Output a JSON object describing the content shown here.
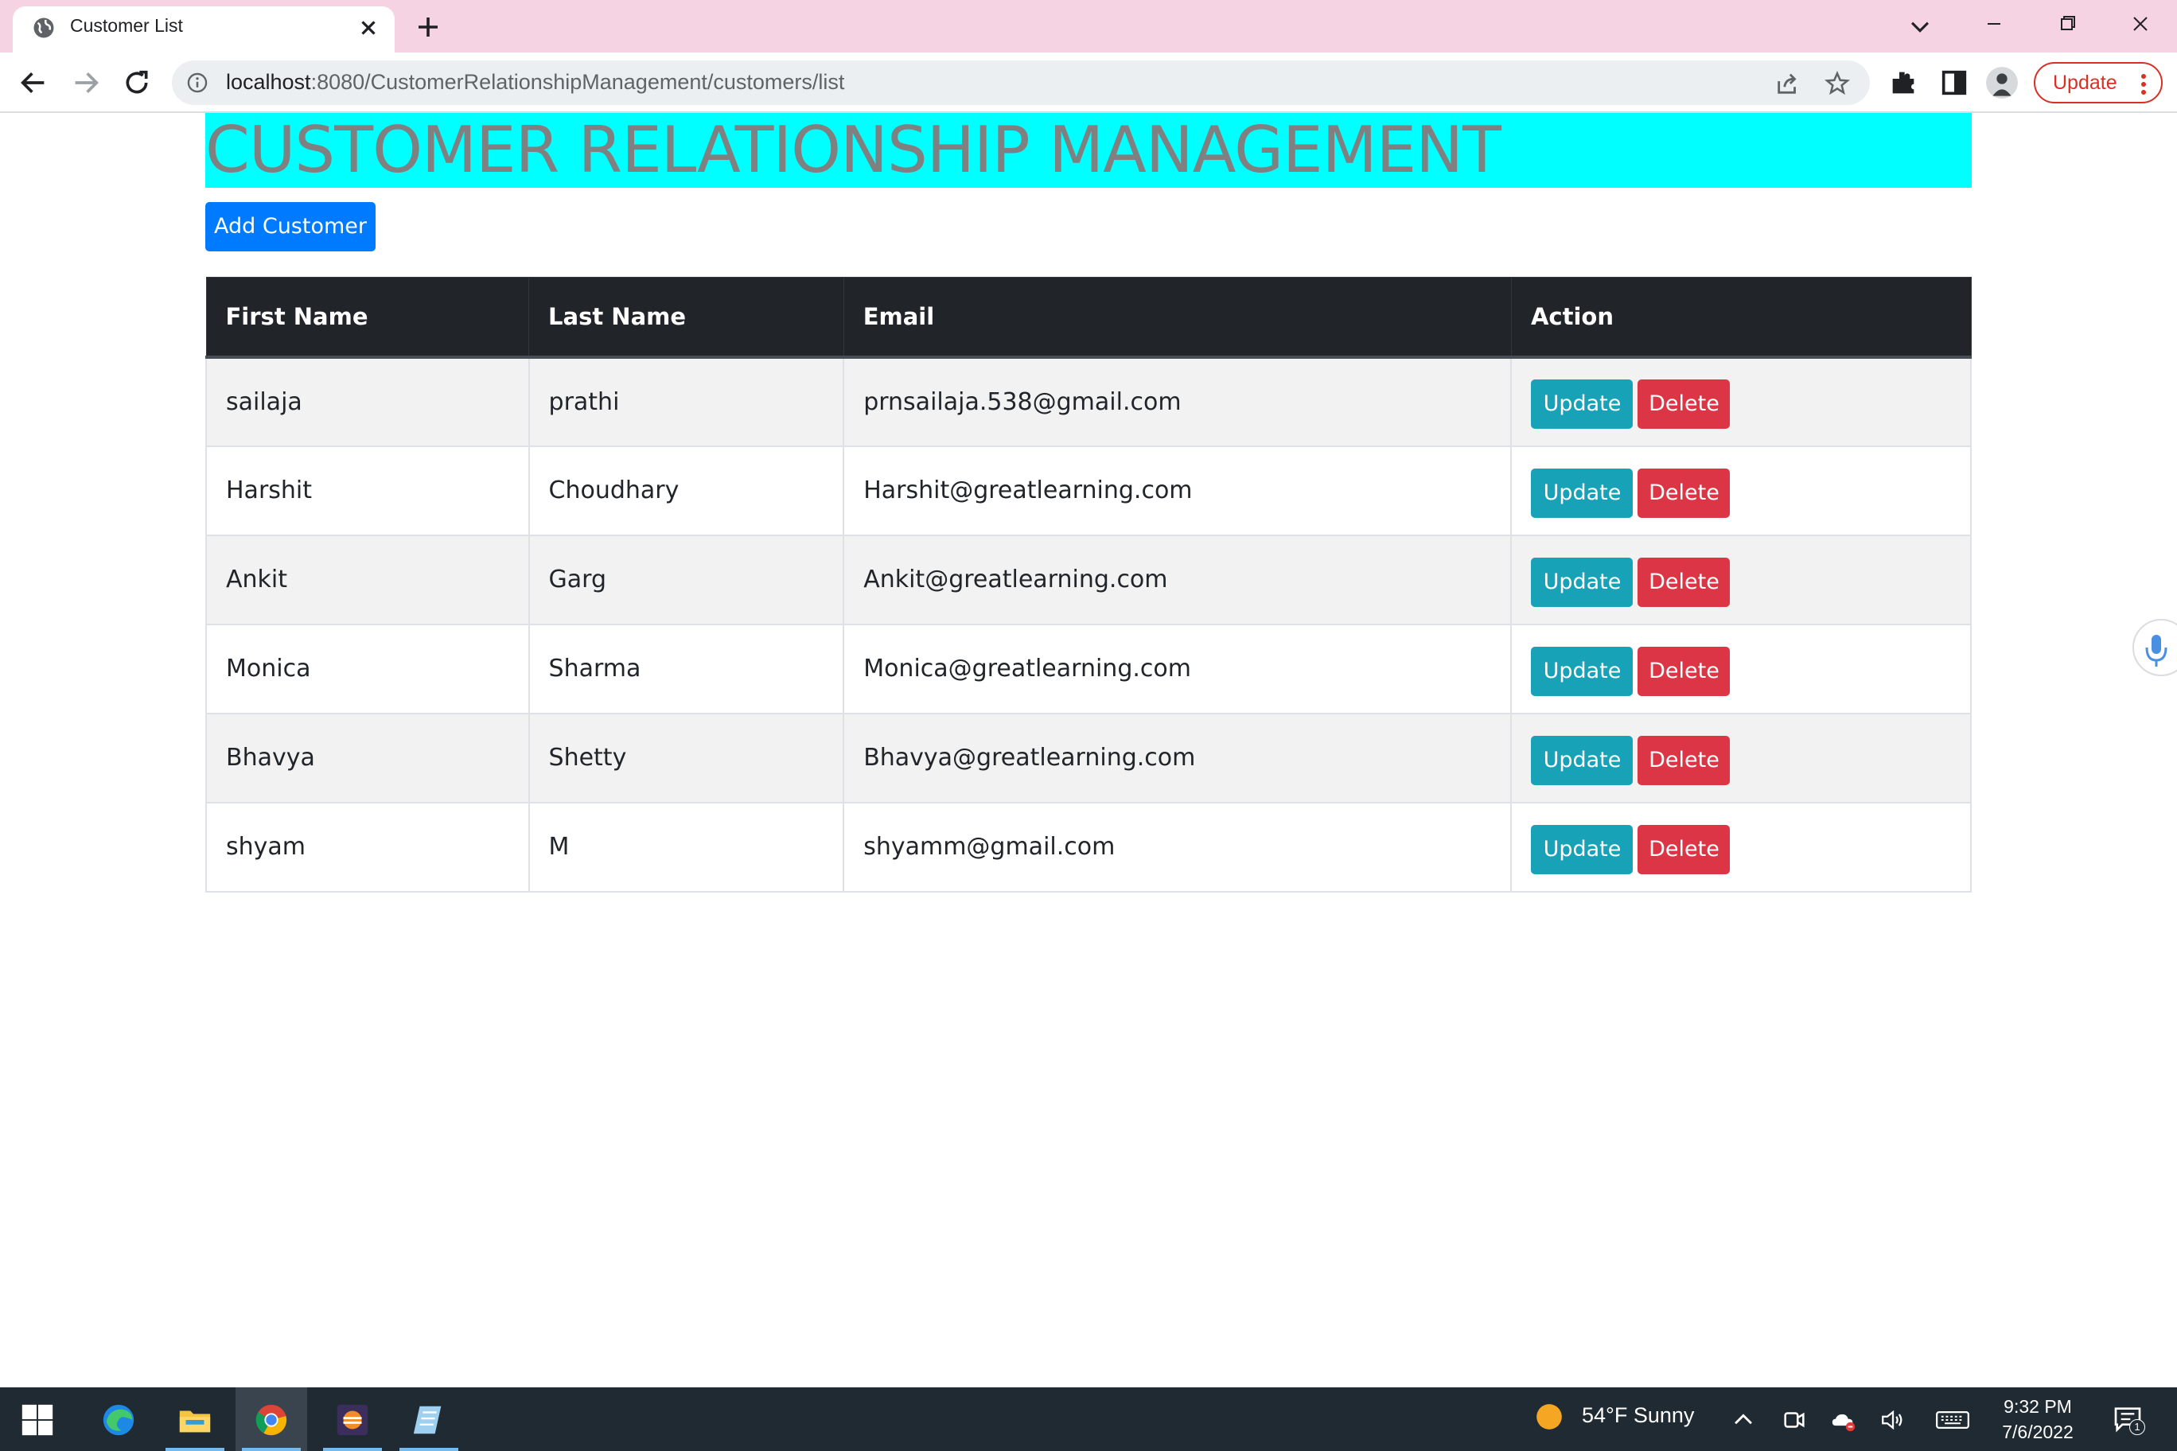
{
  "browser": {
    "tab": {
      "title": "Customer List",
      "favicon": "globe-icon",
      "close_icon": "close-icon"
    },
    "new_tab_icon": "plus-icon",
    "url": {
      "host": "localhost",
      "path": ":8080/CustomerRelationshipManagement/customers/list"
    },
    "update_button": {
      "label": "Update"
    }
  },
  "page": {
    "banner_title": "CUSTOMER RELATIONSHIP MANAGEMENT",
    "add_button": "Add Customer",
    "table": {
      "headers": [
        "First Name",
        "Last Name",
        "Email",
        "Action"
      ],
      "rows": [
        {
          "first": "sailaja",
          "last": "prathi",
          "email": "prnsailaja.538@gmail.com",
          "update": "Update",
          "delete": "Delete"
        },
        {
          "first": "Harshit",
          "last": "Choudhary",
          "email": "Harshit@greatlearning.com",
          "update": "Update",
          "delete": "Delete"
        },
        {
          "first": "Ankit",
          "last": "Garg",
          "email": "Ankit@greatlearning.com",
          "update": "Update",
          "delete": "Delete"
        },
        {
          "first": "Monica",
          "last": "Sharma",
          "email": "Monica@greatlearning.com",
          "update": "Update",
          "delete": "Delete"
        },
        {
          "first": "Bhavya",
          "last": "Shetty",
          "email": "Bhavya@greatlearning.com",
          "update": "Update",
          "delete": "Delete"
        },
        {
          "first": "shyam",
          "last": "M",
          "email": "shyamm@gmail.com",
          "update": "Update",
          "delete": "Delete"
        }
      ]
    }
  },
  "taskbar": {
    "weather": "54°F  Sunny",
    "time": "9:32 PM",
    "date": "7/6/2022",
    "notification_count": "1"
  },
  "colors": {
    "banner_bg": "#00ffff",
    "banner_text": "#808080",
    "primary": "#007bff",
    "info": "#17a2b8",
    "danger": "#dc3545",
    "table_header": "#212529",
    "tab_strip": "#f6d3e2"
  }
}
